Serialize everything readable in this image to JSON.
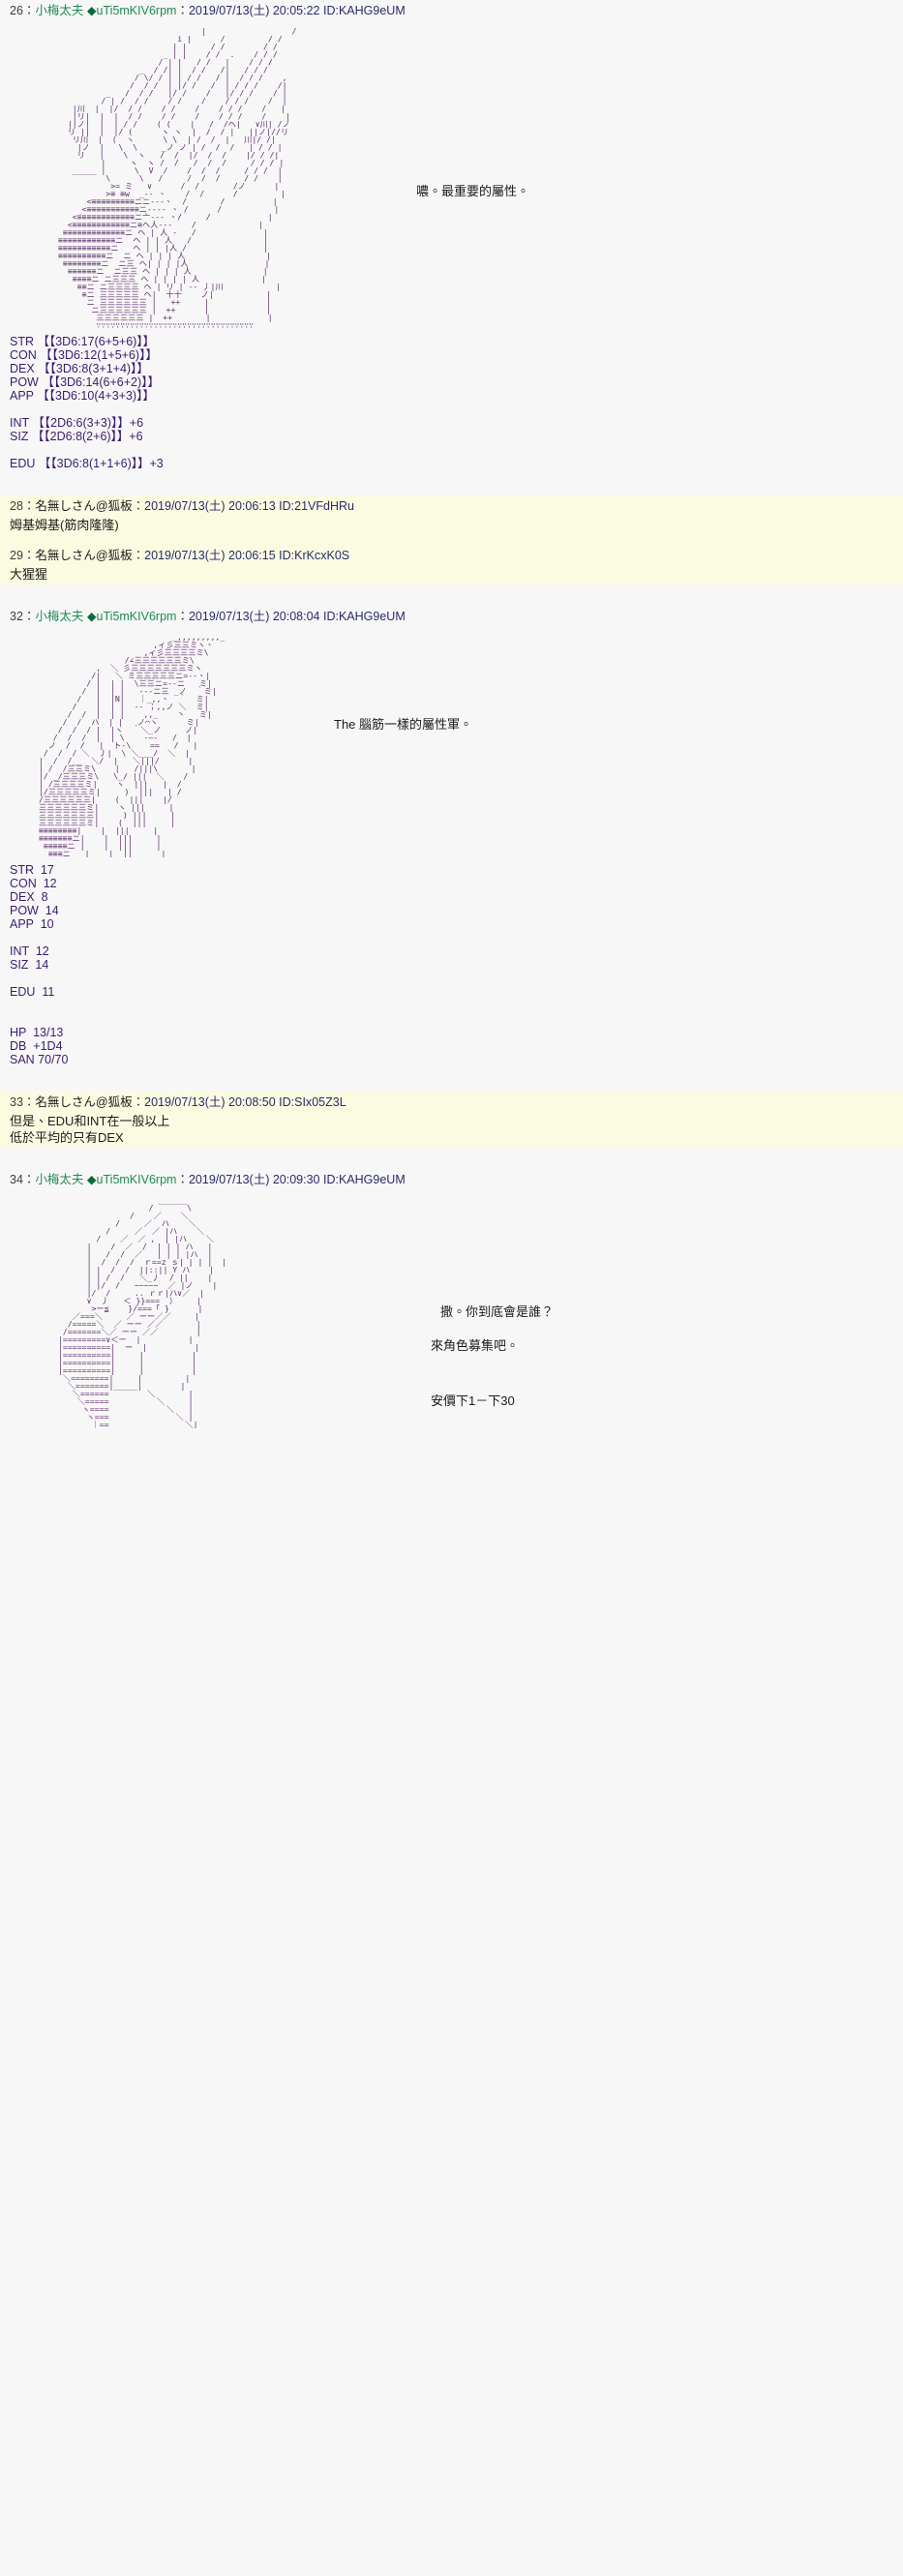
{
  "page": {
    "background_color": "#f7f7f7",
    "anon_post_background": "#fbfbe2",
    "tripcode_name_color": "#1f8a52",
    "datetime_color": "#2a2a6a",
    "aa_art_color": "#5b2a6b",
    "stats_color": "#3a1c6e"
  },
  "posts": [
    {
      "number": "26",
      "colon1": "：",
      "name": "小梅太夫",
      "diamond": "◆",
      "tripcode": "uTi5mKIV6rpm",
      "colon2": "：",
      "date": "2019/07/13(土)",
      "time": "20:05:22",
      "id": "ID:KAHG9eUM",
      "dialog": "噥。最重要的屬性。",
      "stats": "STR 【【3D6:17(6+5+6)】】\nCON 【【3D6:12(1+5+6)】】\nDEX 【【3D6:8(3+1+4)】】\nPOW 【【3D6:14(6+6+2)】】\nAPP 【【3D6:10(4+3+3)】】\n\nINT 【【2D6:6(3+3)】】+6\nSIZ 【【2D6:8(2+6)】】+6\n\nEDU 【【3D6:8(1+1+6)】】+3"
    },
    {
      "number": "28",
      "colon1": "：",
      "name": "名無しさん@狐板",
      "colon2": "：",
      "date": "2019/07/13(土)",
      "time": "20:06:13",
      "id": "ID:21VFdHRu",
      "body": "姆基姆基(筋肉隆隆)"
    },
    {
      "number": "29",
      "colon1": "：",
      "name": "名無しさん@狐板",
      "colon2": "：",
      "date": "2019/07/13(土)",
      "time": "20:06:15",
      "id": "ID:KrKcxK0S",
      "body": "大猩猩"
    },
    {
      "number": "32",
      "colon1": "：",
      "name": "小梅太夫",
      "diamond": "◆",
      "tripcode": "uTi5mKIV6rpm",
      "colon2": "：",
      "date": "2019/07/13(土)",
      "time": "20:08:04",
      "id": "ID:KAHG9eUM",
      "dialog": "The 腦筋一樣的屬性軍。",
      "stats": "STR  17\nCON  12\nDEX  8\nPOW  14\nAPP  10\n\nINT  12\nSIZ  14\n\nEDU  11\n\n\nHP  13/13\nDB  +1D4\nSAN 70/70"
    },
    {
      "number": "33",
      "colon1": "：",
      "name": "名無しさん@狐板",
      "colon2": "：",
      "date": "2019/07/13(土)",
      "time": "20:08:50",
      "id": "ID:SIx05Z3L",
      "body": "但是、EDU和INT在一般以上\n低於平均的只有DEX"
    },
    {
      "number": "34",
      "colon1": "：",
      "name": "小梅太夫",
      "diamond": "◆",
      "tripcode": "uTi5mKIV6rpm",
      "colon2": "：",
      "date": "2019/07/13(土)",
      "time": "20:09:30",
      "id": "ID:KAHG9eUM",
      "dialog_line1": "撒。你到底會是誰？",
      "dialog_line2": "來角色募集吧。",
      "dialog_line3": "安價下1－下30"
    }
  ],
  "aa_art": {
    "art26": "                              |                  /\n                         i |      /         / /\n                        | |     / /        / /\n                      _ | |    / /  .    / / /\n                     / | |   / /   |    / / /\n                 _  / /| |  / /   /|   / / /\n                / \\/ / | | / /   / |  / / /    ,\n               /  / /  | |/ /   /  | / / /    /|\n          _   /  / /   |/ /    /   |/ / /    / |\n         / | /  / /    / /    /    / / /    /  |\n   |川  |  |/  / /    / /    /    / / /    /   |\n   |リ|  |  |  / /    / /    /    / / /    /    |\n  ||ノ|  |  | / /    ( (    |   /  /ヘ|   ∨川| /ノ\n  リ ||  |  |/ (      ヽ ヽ  |  /  / |   ||ノ|//リ\n   リ川  |  (  ヽ      \\ \\  | /  /  |   川|/ /|\n    |ノ  |   \\  \\     _ノ ノ | /  /  /   | / / |\n    リ   |    \\  ヽ   /  /  |/  /  /    |/ / /|\n         |     ヽ  ヽ /  /   /  /  /     / / / |\n   _____ |      \\  V  /    /  /  /     / / /  |\n          \\      \\   /     /  /  /     / /    |\n           >= ミ   ∨      /  /       /ノ      |\n          >≡ ≡w  _-- 、    /  /      /         |\n      <≡≡≡≡≡≡≡≡≡ニニ---、  /       /          |\n     <≡≡≡≡≡≡≡≡≡≡≡ニ---- 、 /      /           |\n   <≡≡≡≡≡≡≡≡≡≡≡≡ニ亠--- 、/     /            |\n  <≡≡≡≡≡≡≡≡≡≡≡≡ニ≡ヘ人---    /             |\n ≡≡≡≡≡≡≡≡≡≡≡≡≡ニ ヘ | 人 -   /              |\n≡≡≡≡≡≡≡≡≡≡≡≡ニ  ヘ | | 人   /               |\n≡≡≡≡≡≡≡≡≡≡≡ニ   ヘ | | |人 /                |\n≡≡≡≡≡≡≡≡≡≡ニ  ニ ヘ | | | 人                 |\n ≡≡≡≡≡≡≡≡ニ  ニ三 ヘ| | | |人                |\n  ≡≡≡≡≡≡ニ  ニ三三 ヘ | | | 人               |\n   ≡≡≡≡ニ ニ三三三 ヘ | | | | 人             |\n    ≡≡ニ ニ三三三三 ヘ | リ | -- 丿|川           |\n     ≡ニ 三三三三三 ヘ|  十十    ノ|           |\n      ニ 三三三三三三 |   ++     |            |\n       ニ三三三三三三 |  ++      |            |\n        三三三三三三 |  ++       |            |\n        ∵∵∵∵∵∵∵∵∵∵∵∵∵∵∵∵∵∵∵∵∵∵∵∵∵∵∵∵∵∵∵∵∵",
    "art32": "                            _,,,,,,,,,_\n                        ,ィ彡三三ミヽ、\n                      ,ィ彡三三三三ミ\\\n                  /∠三三三三三三ミ\\\n            ,  ＼ 彡三三三三三三三ミヽ\n           /|   ＼ ミ三三三三三ニ=--、|\n          / |  | |  \\三三ニ=--ニ   ミ|\n         /  |  | |   ---ニ三 _ノ  ｀ミ|\n        /   |  |N|   ｜_,,、  ｀  ミ|\n       /    |  | |  -- ；,,ノ ＼  ミ|\n      /  /  |  | |    ,,_    丶   ミ|\n     /  /  ハ  | |   ノ⌒ヽ      ミ|\n    /  /  / |  |ヽ  ｀＼_ノ     ノ|\n   /  /  /  |  | \\    -―-   /  |\n  ノ  /  /   |  ト-\\    ==   /   |\n /  /  / ＼  丿|  \\ ＼___/  ＼  |\n|  /  /__  ＼/  |   ＼|||/      |\n| /  /三三ミ\\    |   /|||\\       |\n|/ _/三三三ミ\\   \\_/ |||  ＼    /\n| /三三三三ミ|    ヽ  |||   |  /\n|/三三三三三ミ|     )  |||   | /\n/三三三三三三|    (  |||    |/\n三三三三三三ミ|    ヽ |||     |\n三三三三三三三|     ) |||     |\n三三三三三三ミ|    (  |||     |\n≡≡≡≡≡≡≡≡|    |  |||     |\n≡≡≡≡≡≡≡ニ|    |  |||     |\n ≡≡≡≡≡ニ |    |  |||     |\n  ≡≡≡ニ   |    |  ||      |",
    "art34": "                     ______\n                   /       \\\n               /    ／    ＼\n            /     ／  ハ    ＼\n          /     ／  ／ |ハ    ＼\n        /    ／  ／ ,  | |ハ    ＼\n      |    /  ／  /  | | | ハ   |\n      |   /  /  ／   | | | |ハ  |\n      |  /  /  /  ｒ==z ｓ| | | |  |\n      | |  /  /  ||::|| Y ハ    |\n      | | /  /   ＼_丿  / ||    |\n      | |/  /   ~~~~~  ／ |ノ    |\n      |/  /     .. ｒｒ|ハ∨／  |\n      ∨  丿   ＜ }}===  ）    |\n       >ー≦    }/===「 }      |\n   ／===＼     ／ ーー／／     |\n  /=====＼  ／ ーー ／／       |\n /=======＼／ ーー ／／        |\n|=========∨＜ー  |          |\n|==========|  ー  |          |\n|==========|     |          |\n|==========|     |          |\n|==========|     |          |\n ＼========|     |         |\n  ＼=======|_____|        |\n   ＼======        ＼       |\n    ＼=====          ＼     |\n     ヽ====            ＼   |\n      ヽ===              ＼ |\n       ｜==                ＼|"
  }
}
